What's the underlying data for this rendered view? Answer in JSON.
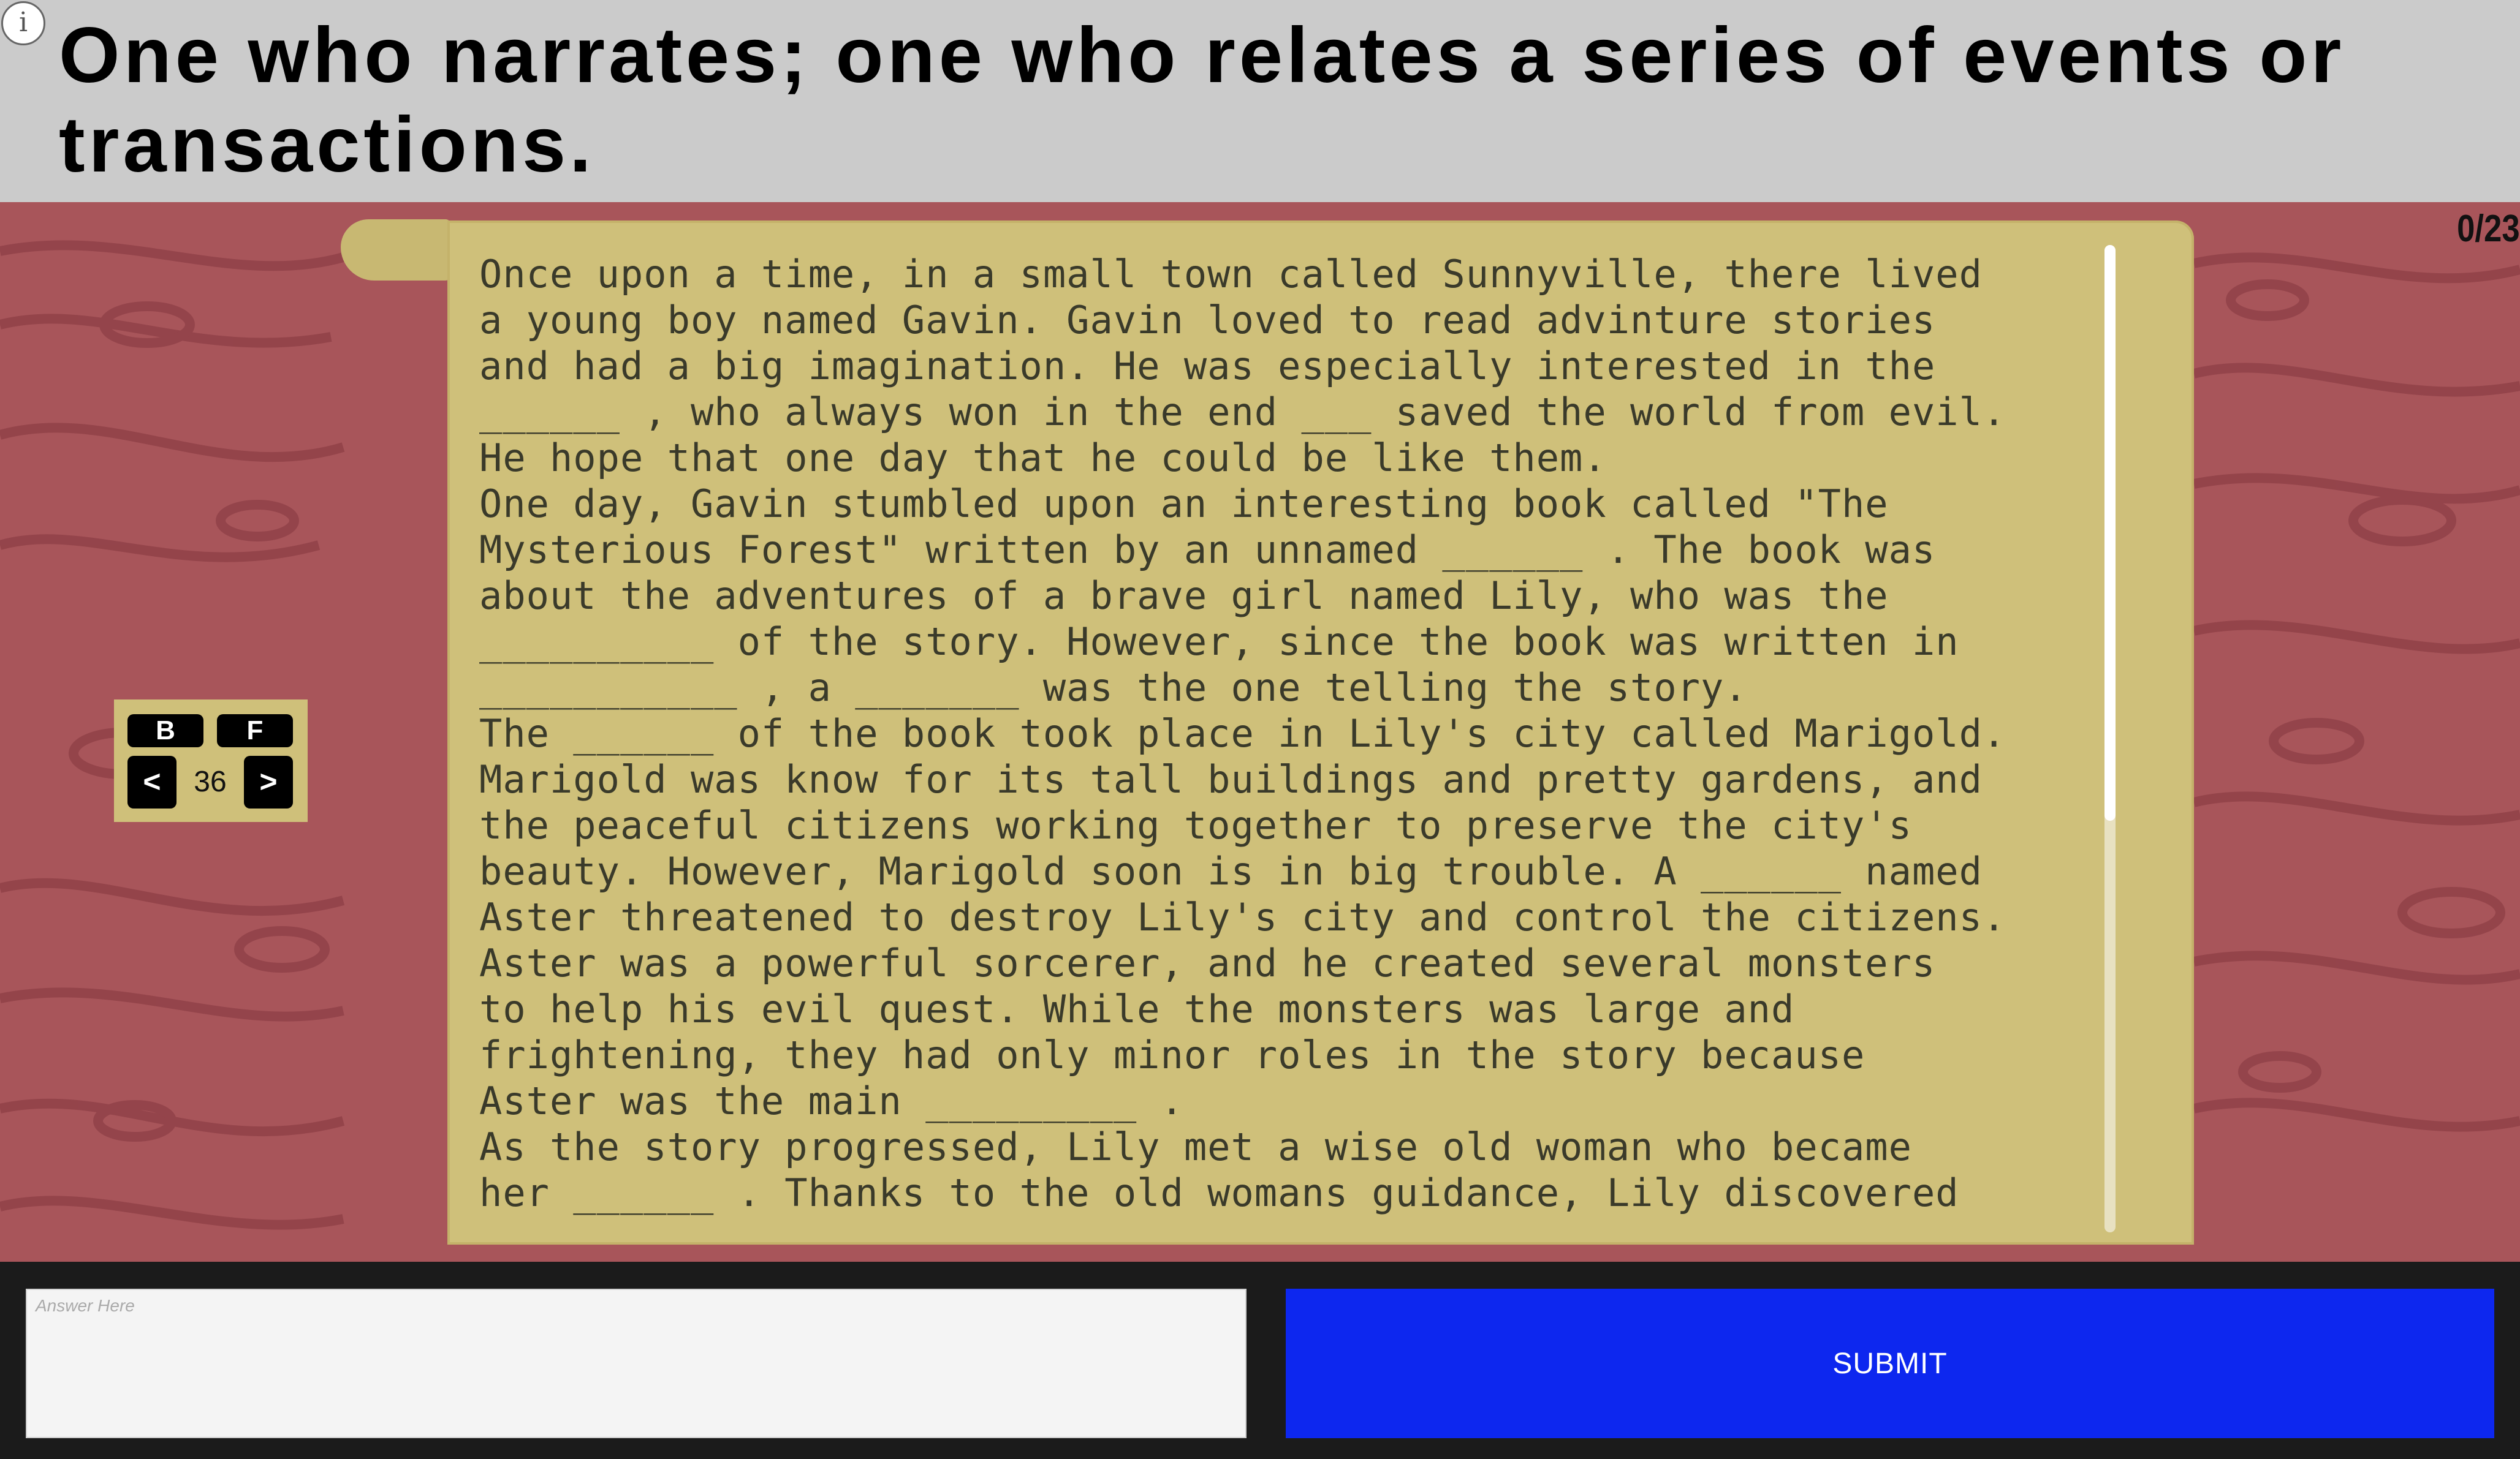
{
  "header": {
    "info_icon": "i",
    "clue": "One who narrates; one who relates a series of events or transactions."
  },
  "score": "0/23",
  "nav": {
    "back_label": "B",
    "forward_label": "F",
    "prev_label": "<",
    "next_label": ">",
    "page_number": "36"
  },
  "story": {
    "text": "Once upon a time, in a small town called Sunnyville, there lived\na young boy named Gavin. Gavin loved to read advinture stories\nand had a big imagination. He was especially interested in the\n______ , who always won in the end ___ saved the world from evil.\nHe hope that one day that he could be like them.\nOne day, Gavin stumbled upon an interesting book called \"The\nMysterious Forest\" written by an unnamed ______ . The book was\nabout the adventures of a brave girl named Lily, who was the\n__________ of the story. However, since the book was written in\n___________ , a _______ was the one telling the story.\nThe ______ of the book took place in Lily's city called Marigold.\nMarigold was know for its tall buildings and pretty gardens, and\nthe peaceful citizens working together to preserve the city's\nbeauty. However, Marigold soon is in big trouble. A ______ named\nAster threatened to destroy Lily's city and control the citizens.\nAster was a powerful sorcerer, and he created several monsters\nto help his evil quest. While the monsters was large and\nfrightening, they had only minor roles in the story because\nAster was the main _________ .\nAs the story progressed, Lily met a wise old woman who became\nher ______ . Thanks to the old womans guidance, Lily discovered"
  },
  "answer": {
    "placeholder": "Answer Here",
    "value": ""
  },
  "submit_label": "SUBMIT",
  "colors": {
    "wood": "#a8555a",
    "parchment": "#cfc07a",
    "submit": "#0d27ef"
  }
}
